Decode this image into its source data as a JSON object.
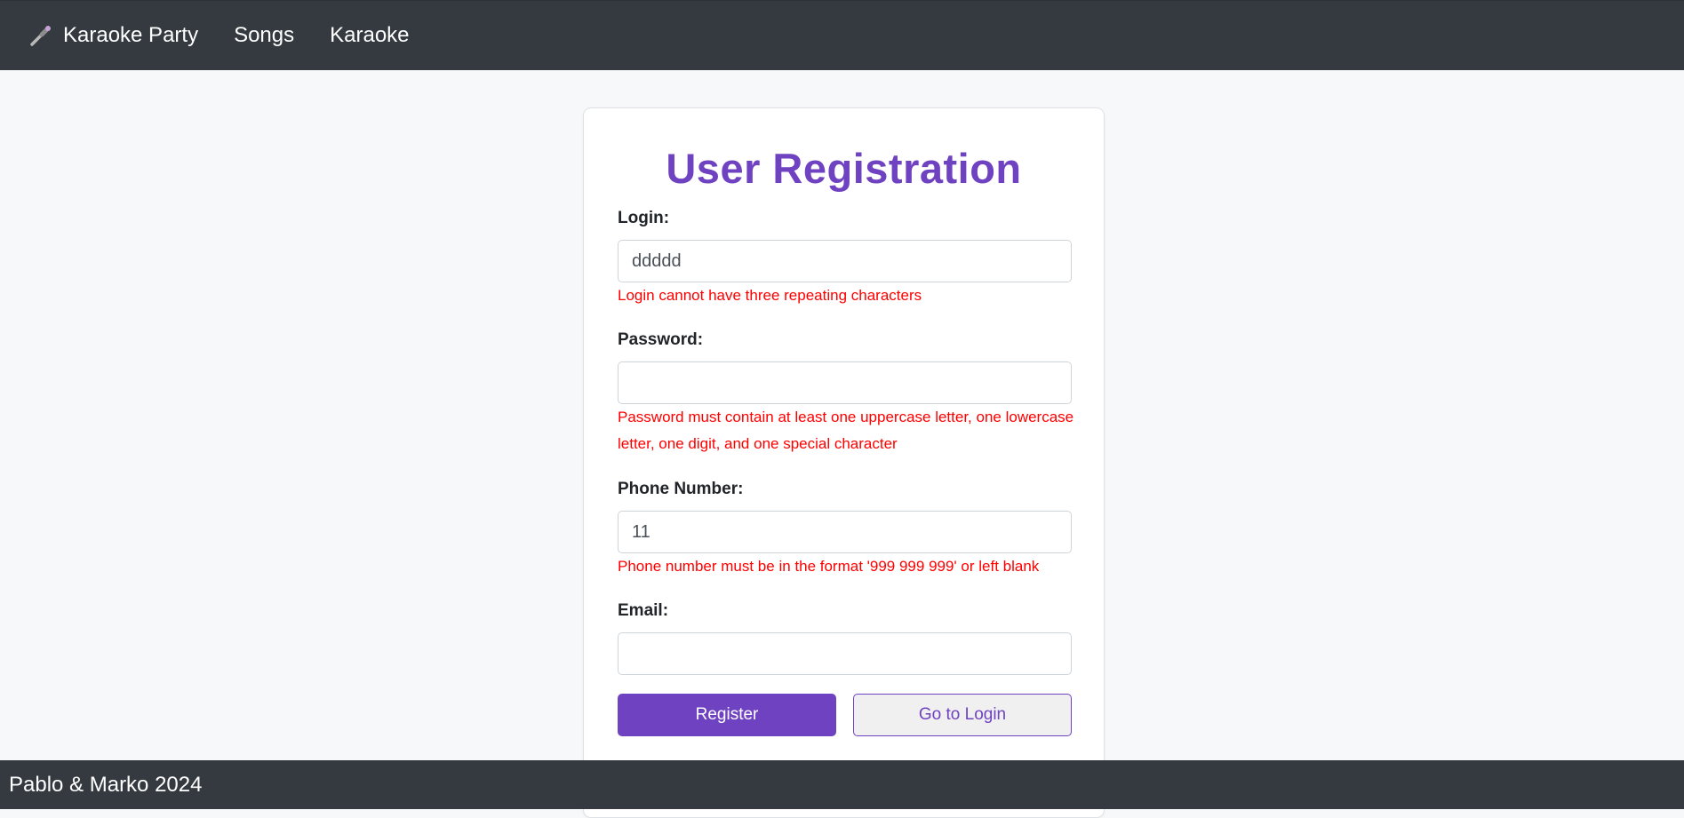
{
  "navbar": {
    "brand_label": "Karaoke Party",
    "brand_icon": "microphone-icon",
    "links": [
      "Songs",
      "Karaoke"
    ]
  },
  "form": {
    "title": "User Registration",
    "login": {
      "label": "Login:",
      "value": "ddddd",
      "error": "Login cannot have three repeating characters"
    },
    "password": {
      "label": "Password:",
      "value": "",
      "error": "Password must contain at least one uppercase letter, one lowercase letter, one digit, and one special character"
    },
    "phone": {
      "label": "Phone Number:",
      "value": "11",
      "error": "Phone number must be in the format '999 999 999' or left blank"
    },
    "email": {
      "label": "Email:",
      "value": ""
    },
    "register_label": "Register",
    "go_to_login_label": "Go to Login"
  },
  "footer": {
    "text": "Pablo & Marko 2024"
  },
  "colors": {
    "accent": "#6f42c1",
    "navbar": "#343a40",
    "error": "#ff0000",
    "background": "#f7f8f9"
  }
}
